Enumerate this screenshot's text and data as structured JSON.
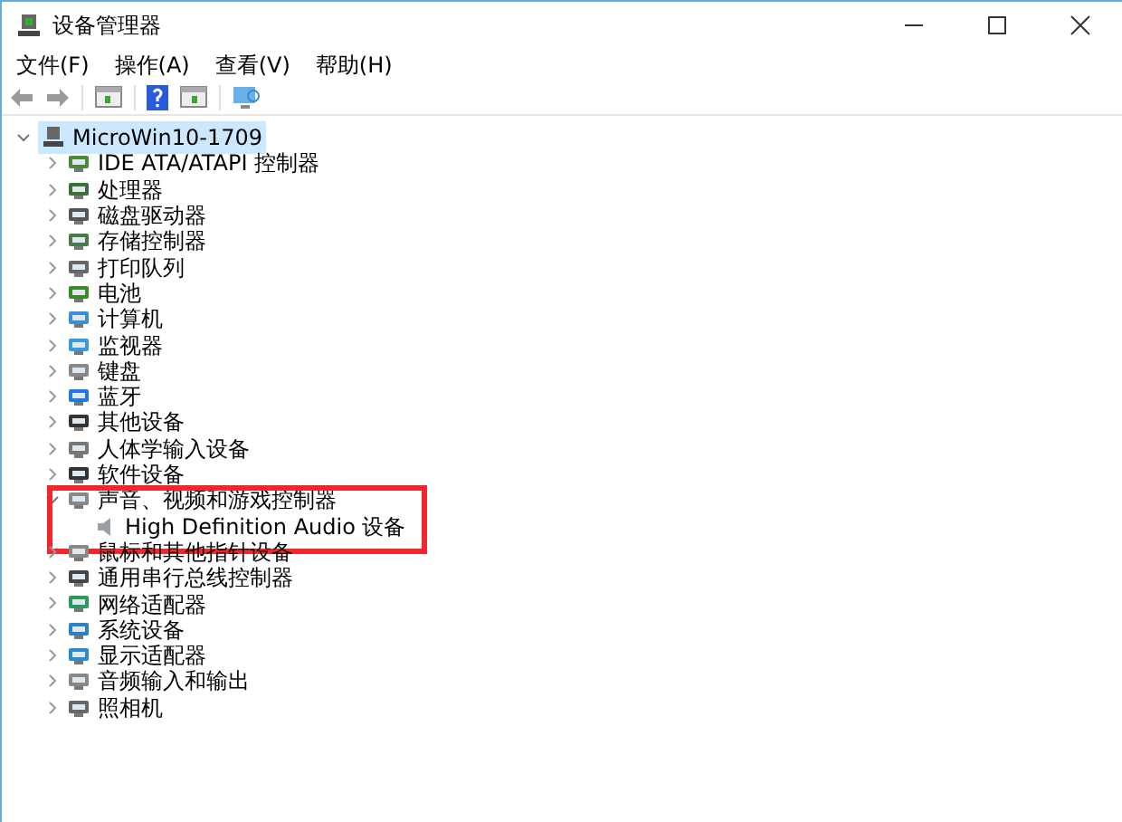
{
  "window": {
    "title": "设备管理器"
  },
  "menu": [
    "文件(F)",
    "操作(A)",
    "查看(V)",
    "帮助(H)"
  ],
  "tree": {
    "label": "MicroWin10-1709",
    "expanded": true,
    "selected": true,
    "children": [
      {
        "label": "IDE ATA/ATAPI 控制器",
        "expanded": false
      },
      {
        "label": "处理器",
        "expanded": false
      },
      {
        "label": "磁盘驱动器",
        "expanded": false
      },
      {
        "label": "存储控制器",
        "expanded": false
      },
      {
        "label": "打印队列",
        "expanded": false
      },
      {
        "label": "电池",
        "expanded": false
      },
      {
        "label": "计算机",
        "expanded": false
      },
      {
        "label": "监视器",
        "expanded": false
      },
      {
        "label": "键盘",
        "expanded": false
      },
      {
        "label": "蓝牙",
        "expanded": false
      },
      {
        "label": "其他设备",
        "expanded": false
      },
      {
        "label": "人体学输入设备",
        "expanded": false
      },
      {
        "label": "软件设备",
        "expanded": false
      },
      {
        "label": "声音、视频和游戏控制器",
        "expanded": true,
        "highlighted": true,
        "children": [
          {
            "label": "High Definition Audio 设备"
          }
        ]
      },
      {
        "label": "鼠标和其他指针设备",
        "expanded": false
      },
      {
        "label": "通用串行总线控制器",
        "expanded": false
      },
      {
        "label": "网络适配器",
        "expanded": false
      },
      {
        "label": "系统设备",
        "expanded": false
      },
      {
        "label": "显示适配器",
        "expanded": false
      },
      {
        "label": "音频输入和输出",
        "expanded": false
      },
      {
        "label": "照相机",
        "expanded": false
      }
    ]
  }
}
